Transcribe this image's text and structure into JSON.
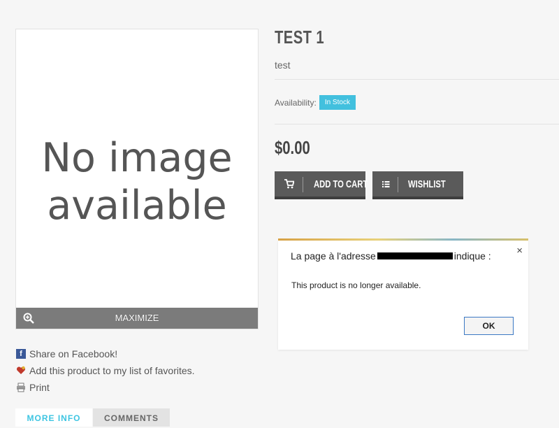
{
  "image_panel": {
    "placeholder_line1": "No image",
    "placeholder_line2": "available",
    "maximize_label": "MAXIMIZE"
  },
  "share_links": [
    {
      "label": "Share on Facebook!",
      "icon": "facebook-icon"
    },
    {
      "label": "Add this product to my list of favorites.",
      "icon": "heart-icon"
    },
    {
      "label": "Print",
      "icon": "printer-icon"
    }
  ],
  "tabs": [
    {
      "label": "MORE INFO"
    },
    {
      "label": "COMMENTS"
    }
  ],
  "product": {
    "title": "TEST 1",
    "description": "test",
    "availability_label": "Availability:",
    "stock_status": "In Stock",
    "price": "$0.00"
  },
  "buttons": {
    "add_to_cart": "ADD TO CART",
    "wishlist": "WISHLIST"
  },
  "dialog": {
    "heading_prefix": "La page à l'adresse",
    "heading_suffix": "indique :",
    "message": "This product is no longer available.",
    "ok_label": "OK",
    "close_symbol": "×"
  },
  "colors": {
    "accent": "#42c0de",
    "button_dark": "#5a5a5a",
    "maximize_bar": "#7b7b7b"
  }
}
